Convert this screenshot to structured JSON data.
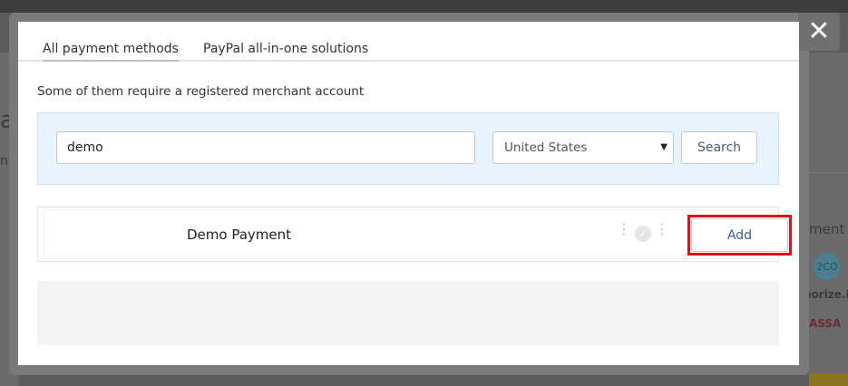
{
  "background": {
    "fragments": [
      "a",
      "nf",
      "ment",
      "2CO",
      "horize.N",
      "ASSA"
    ]
  },
  "modal": {
    "close_label": "✕",
    "tabs": [
      {
        "label": "All payment methods",
        "active": true
      },
      {
        "label": "PayPal all-in-one solutions",
        "active": false
      }
    ],
    "subtitle": "Some of them require a registered merchant account",
    "search": {
      "value": "demo",
      "country": "United States",
      "caret": "▼",
      "button_label": "Search"
    },
    "results": [
      {
        "name": "Demo Payment",
        "dots": "⋮",
        "check": "✓",
        "add_label": "Add"
      }
    ]
  },
  "colors": {
    "accent_text": "#3a5f86",
    "highlight": "#e0101c",
    "search_panel_bg": "#e8f4fd"
  }
}
